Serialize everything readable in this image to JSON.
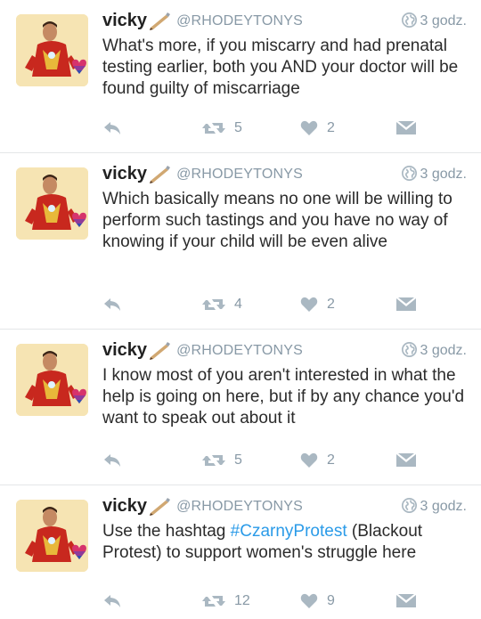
{
  "tweets": [
    {
      "name": "vicky",
      "handle": "@RHODEYTONYS",
      "time": "3 godz.",
      "text_before": "What's more, if you miscarry and had prenatal testing earlier, both you AND your doctor will be found guilty of miscarriage",
      "hashtag": "",
      "text_after": "",
      "retweets": "5",
      "likes": "2"
    },
    {
      "name": "vicky",
      "handle": "@RHODEYTONYS",
      "time": "3 godz.",
      "text_before": "Which basically means no one will be willing to perform such tastings and you have no way of knowing if your child will be even alive",
      "hashtag": "",
      "text_after": "",
      "retweets": "4",
      "likes": "2"
    },
    {
      "name": "vicky",
      "handle": "@RHODEYTONYS",
      "time": "3 godz.",
      "text_before": "I know most of you aren't interested in what the help is going on here, but if by any chance you'd want to speak out about it",
      "hashtag": "",
      "text_after": "",
      "retweets": "5",
      "likes": "2"
    },
    {
      "name": "vicky",
      "handle": "@RHODEYTONYS",
      "time": "3 godz.",
      "text_before": "Use the hashtag ",
      "hashtag": "#CzarnyProtest",
      "text_after": " (Blackout Protest) to support women's struggle here",
      "retweets": "12",
      "likes": "9"
    }
  ],
  "colors": {
    "accent": "#2b9be8",
    "muted": "#8899a6",
    "icon": "#aab8c2",
    "avatar_bg": "#f6e4b3"
  },
  "icons": {
    "reply": "reply-icon",
    "retweet": "retweet-icon",
    "like": "heart-icon",
    "dm": "envelope-icon",
    "globe": "globe-icon",
    "pen": "pen-icon"
  }
}
